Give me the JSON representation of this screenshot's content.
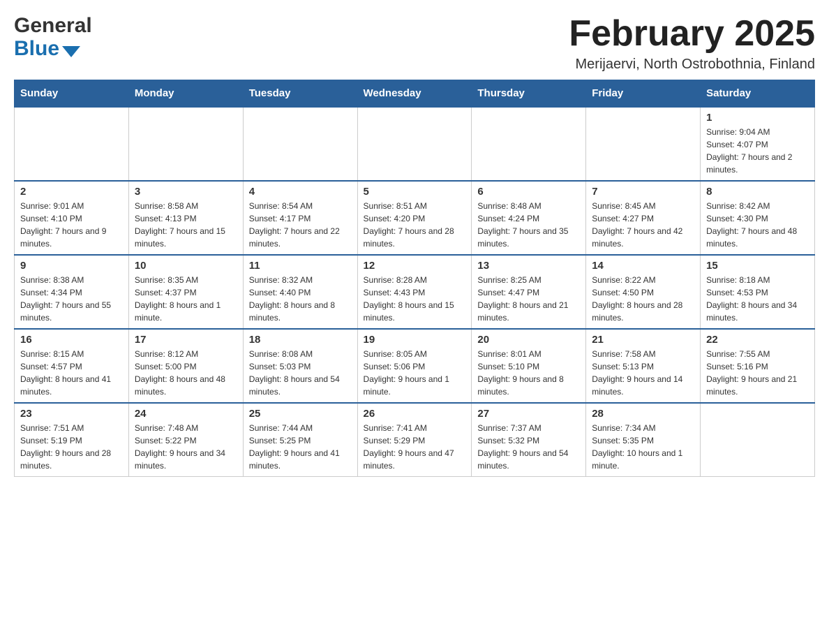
{
  "header": {
    "month_title": "February 2025",
    "location": "Merijaervi, North Ostrobothnia, Finland",
    "logo_general": "General",
    "logo_blue": "Blue"
  },
  "days_of_week": [
    "Sunday",
    "Monday",
    "Tuesday",
    "Wednesday",
    "Thursday",
    "Friday",
    "Saturday"
  ],
  "weeks": [
    {
      "days": [
        {
          "num": "",
          "info": ""
        },
        {
          "num": "",
          "info": ""
        },
        {
          "num": "",
          "info": ""
        },
        {
          "num": "",
          "info": ""
        },
        {
          "num": "",
          "info": ""
        },
        {
          "num": "",
          "info": ""
        },
        {
          "num": "1",
          "info": "Sunrise: 9:04 AM\nSunset: 4:07 PM\nDaylight: 7 hours and 2 minutes."
        }
      ]
    },
    {
      "days": [
        {
          "num": "2",
          "info": "Sunrise: 9:01 AM\nSunset: 4:10 PM\nDaylight: 7 hours and 9 minutes."
        },
        {
          "num": "3",
          "info": "Sunrise: 8:58 AM\nSunset: 4:13 PM\nDaylight: 7 hours and 15 minutes."
        },
        {
          "num": "4",
          "info": "Sunrise: 8:54 AM\nSunset: 4:17 PM\nDaylight: 7 hours and 22 minutes."
        },
        {
          "num": "5",
          "info": "Sunrise: 8:51 AM\nSunset: 4:20 PM\nDaylight: 7 hours and 28 minutes."
        },
        {
          "num": "6",
          "info": "Sunrise: 8:48 AM\nSunset: 4:24 PM\nDaylight: 7 hours and 35 minutes."
        },
        {
          "num": "7",
          "info": "Sunrise: 8:45 AM\nSunset: 4:27 PM\nDaylight: 7 hours and 42 minutes."
        },
        {
          "num": "8",
          "info": "Sunrise: 8:42 AM\nSunset: 4:30 PM\nDaylight: 7 hours and 48 minutes."
        }
      ]
    },
    {
      "days": [
        {
          "num": "9",
          "info": "Sunrise: 8:38 AM\nSunset: 4:34 PM\nDaylight: 7 hours and 55 minutes."
        },
        {
          "num": "10",
          "info": "Sunrise: 8:35 AM\nSunset: 4:37 PM\nDaylight: 8 hours and 1 minute."
        },
        {
          "num": "11",
          "info": "Sunrise: 8:32 AM\nSunset: 4:40 PM\nDaylight: 8 hours and 8 minutes."
        },
        {
          "num": "12",
          "info": "Sunrise: 8:28 AM\nSunset: 4:43 PM\nDaylight: 8 hours and 15 minutes."
        },
        {
          "num": "13",
          "info": "Sunrise: 8:25 AM\nSunset: 4:47 PM\nDaylight: 8 hours and 21 minutes."
        },
        {
          "num": "14",
          "info": "Sunrise: 8:22 AM\nSunset: 4:50 PM\nDaylight: 8 hours and 28 minutes."
        },
        {
          "num": "15",
          "info": "Sunrise: 8:18 AM\nSunset: 4:53 PM\nDaylight: 8 hours and 34 minutes."
        }
      ]
    },
    {
      "days": [
        {
          "num": "16",
          "info": "Sunrise: 8:15 AM\nSunset: 4:57 PM\nDaylight: 8 hours and 41 minutes."
        },
        {
          "num": "17",
          "info": "Sunrise: 8:12 AM\nSunset: 5:00 PM\nDaylight: 8 hours and 48 minutes."
        },
        {
          "num": "18",
          "info": "Sunrise: 8:08 AM\nSunset: 5:03 PM\nDaylight: 8 hours and 54 minutes."
        },
        {
          "num": "19",
          "info": "Sunrise: 8:05 AM\nSunset: 5:06 PM\nDaylight: 9 hours and 1 minute."
        },
        {
          "num": "20",
          "info": "Sunrise: 8:01 AM\nSunset: 5:10 PM\nDaylight: 9 hours and 8 minutes."
        },
        {
          "num": "21",
          "info": "Sunrise: 7:58 AM\nSunset: 5:13 PM\nDaylight: 9 hours and 14 minutes."
        },
        {
          "num": "22",
          "info": "Sunrise: 7:55 AM\nSunset: 5:16 PM\nDaylight: 9 hours and 21 minutes."
        }
      ]
    },
    {
      "days": [
        {
          "num": "23",
          "info": "Sunrise: 7:51 AM\nSunset: 5:19 PM\nDaylight: 9 hours and 28 minutes."
        },
        {
          "num": "24",
          "info": "Sunrise: 7:48 AM\nSunset: 5:22 PM\nDaylight: 9 hours and 34 minutes."
        },
        {
          "num": "25",
          "info": "Sunrise: 7:44 AM\nSunset: 5:25 PM\nDaylight: 9 hours and 41 minutes."
        },
        {
          "num": "26",
          "info": "Sunrise: 7:41 AM\nSunset: 5:29 PM\nDaylight: 9 hours and 47 minutes."
        },
        {
          "num": "27",
          "info": "Sunrise: 7:37 AM\nSunset: 5:32 PM\nDaylight: 9 hours and 54 minutes."
        },
        {
          "num": "28",
          "info": "Sunrise: 7:34 AM\nSunset: 5:35 PM\nDaylight: 10 hours and 1 minute."
        },
        {
          "num": "",
          "info": ""
        }
      ]
    }
  ]
}
